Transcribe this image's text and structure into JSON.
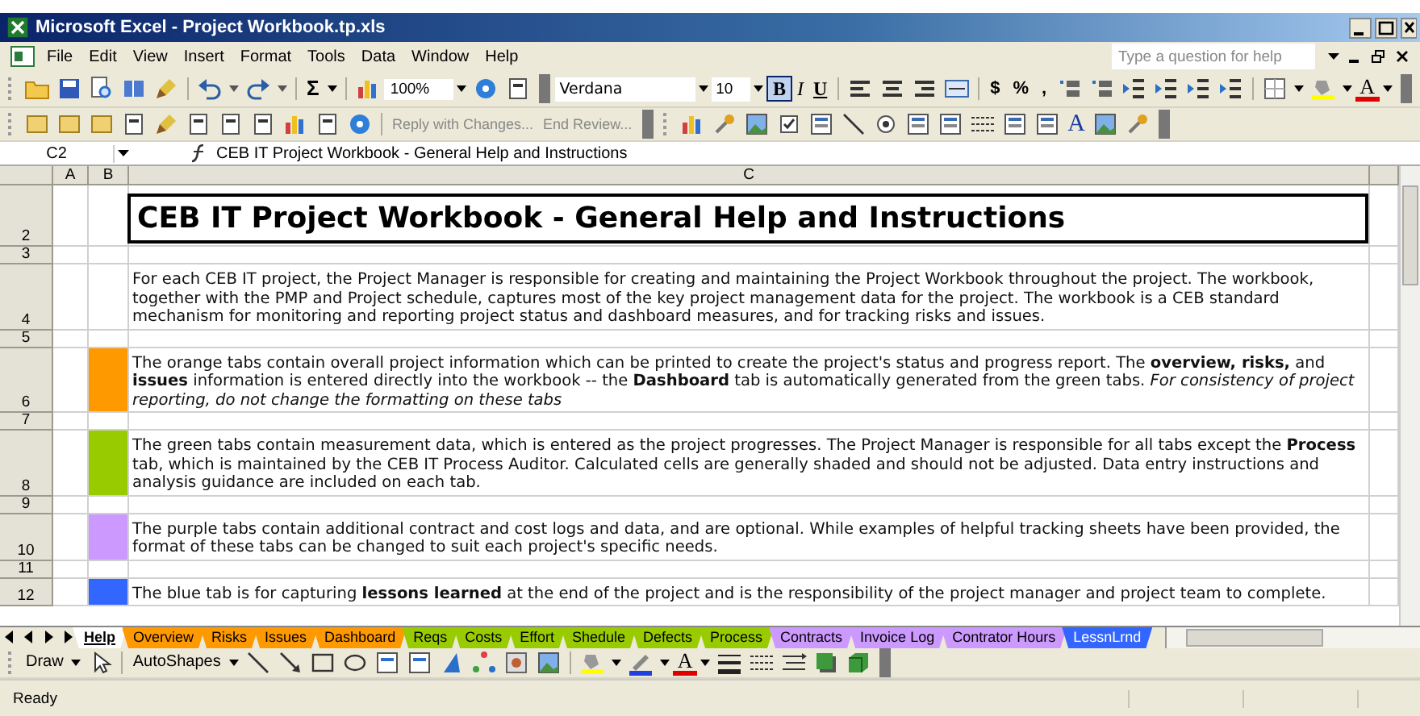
{
  "window": {
    "title": "Microsoft Excel - Project Workbook.tp.xls"
  },
  "menu": [
    "File",
    "Edit",
    "View",
    "Insert",
    "Format",
    "Tools",
    "Data",
    "Window",
    "Help"
  ],
  "help_box": {
    "placeholder": "Type a question for help"
  },
  "standard_toolbar": {
    "sum": "Σ",
    "zoom": "100%"
  },
  "formatting_toolbar": {
    "font": "Verdana",
    "size": "10",
    "styles": [
      {
        "label": "B",
        "selected": true
      },
      {
        "label": "I",
        "selected": false
      },
      {
        "label": "U",
        "selected": false
      }
    ],
    "number_formats": [
      "$",
      "%",
      ","
    ],
    "font_color": "A"
  },
  "reviewing_toolbar": {
    "buttons": [
      "Reply with Changes...",
      "End Review..."
    ]
  },
  "forms_toolbar": {
    "label": "A"
  },
  "formula_bar": {
    "name_box": "C2",
    "formula": "CEB IT Project Workbook - General Help and Instructions"
  },
  "columns": [
    "A",
    "B",
    "C"
  ],
  "rows": [
    {
      "number": "2",
      "kind": "title",
      "text": "CEB IT Project Workbook - General Help and Instructions"
    },
    {
      "number": "3",
      "kind": "blank"
    },
    {
      "number": "4",
      "kind": "text",
      "text": "For each CEB IT project, the Project Manager is responsible for creating and maintaining the Project Workbook throughout the project. The workbook, together with the PMP and Project schedule, captures most of the key project management data for the project.  The workbook is a CEB standard mechanism for monitoring and reporting project status and dashboard measures, and for tracking risks and issues."
    },
    {
      "number": "5",
      "kind": "blank"
    },
    {
      "number": "6",
      "kind": "text",
      "color": "#ff9900",
      "text": "The orange tabs contain overall project information which can be printed to create the project's status and progress report.  The **overview, risks,** and **issues** information is entered directly into the workbook -- the **Dashboard** tab is automatically generated from the green tabs.  *For consistency of project reporting,  do not change the formatting on these tabs*"
    },
    {
      "number": "7",
      "kind": "blank"
    },
    {
      "number": "8",
      "kind": "text",
      "color": "#99cc00",
      "text": "The green tabs contain measurement data, which is entered as the project progresses.  The Project Manager is responsible for all tabs except the **Process** tab, which is maintained by the CEB IT Process Auditor.  Calculated cells are generally shaded and should not be adjusted.  Data entry instructions and analysis guidance are included on each tab."
    },
    {
      "number": "9",
      "kind": "blank"
    },
    {
      "number": "10",
      "kind": "text",
      "color": "#cc99ff",
      "text": "The purple tabs contain additional contract and cost logs and data, and are optional.  While examples of helpful tracking sheets have been provided, the format of these tabs can be changed to suit each project's specific needs."
    },
    {
      "number": "11",
      "kind": "blank"
    },
    {
      "number": "12",
      "kind": "text",
      "color": "#3366ff",
      "text": "The blue tab is for capturing **lessons learned** at the end of the project and is the responsibility of the project manager and project team to complete."
    }
  ],
  "sheet_tabs": [
    {
      "label": "Help",
      "selected": true
    },
    {
      "label": "Overview",
      "color": "#ff9900",
      "selected": false
    },
    {
      "label": "Risks",
      "color": "#ff9900",
      "selected": false
    },
    {
      "label": "Issues",
      "color": "#ff9900",
      "selected": false
    },
    {
      "label": "Dashboard",
      "color": "#ff9900",
      "selected": false
    },
    {
      "label": "Reqs",
      "color": "#99cc00",
      "selected": false
    },
    {
      "label": "Costs",
      "color": "#99cc00",
      "selected": false
    },
    {
      "label": "Effort",
      "color": "#99cc00",
      "selected": false
    },
    {
      "label": "Shedule",
      "color": "#99cc00",
      "selected": false
    },
    {
      "label": "Defects",
      "color": "#99cc00",
      "selected": false
    },
    {
      "label": "Process",
      "color": "#99cc00",
      "selected": false
    },
    {
      "label": "Contracts",
      "color": "#cc99ff",
      "selected": false
    },
    {
      "label": "Invoice Log",
      "color": "#cc99ff",
      "selected": false
    },
    {
      "label": "Contrator Hours",
      "color": "#cc99ff",
      "selected": false
    },
    {
      "label": "LessnLrnd",
      "color": "#3366ff",
      "selected": false
    }
  ],
  "drawing_toolbar": {
    "draw": "Draw",
    "autoshapes": "AutoShapes",
    "font_color": "A"
  },
  "status_bar": {
    "text": "Ready"
  }
}
